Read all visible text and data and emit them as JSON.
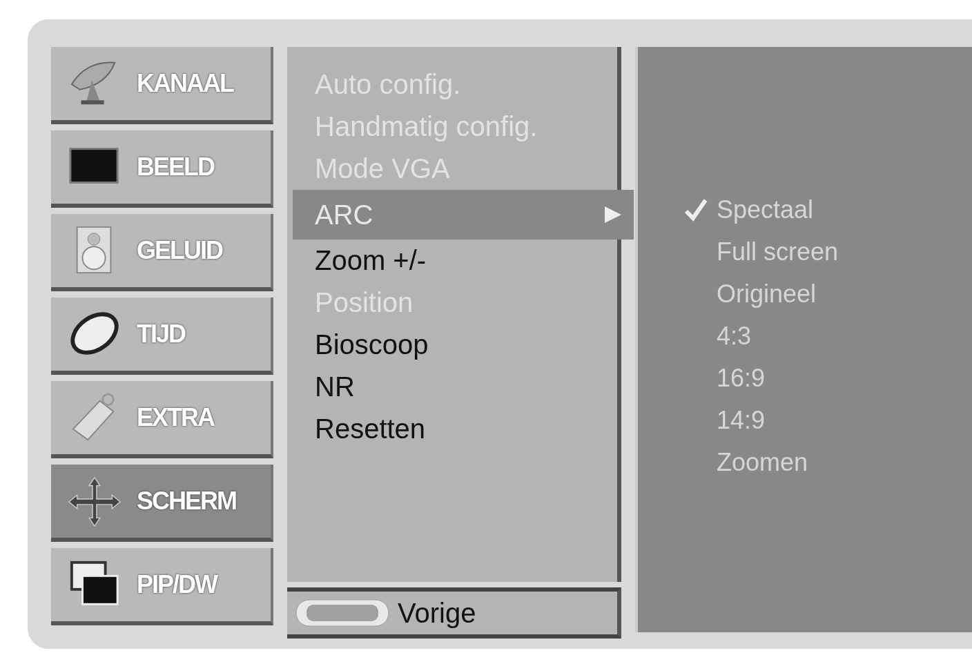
{
  "main_menu": [
    {
      "label": "KANAAL",
      "selected": false
    },
    {
      "label": "BEELD",
      "selected": false
    },
    {
      "label": "GELUID",
      "selected": false
    },
    {
      "label": "TIJD",
      "selected": false
    },
    {
      "label": "EXTRA",
      "selected": false
    },
    {
      "label": "SCHERM",
      "selected": true
    },
    {
      "label": "PIP/DW",
      "selected": false
    }
  ],
  "submenu": {
    "items": [
      {
        "label": "Auto config.",
        "disabled": true,
        "selected": false,
        "has_submenu": false
      },
      {
        "label": "Handmatig config.",
        "disabled": true,
        "selected": false,
        "has_submenu": false
      },
      {
        "label": "Mode VGA",
        "disabled": true,
        "selected": false,
        "has_submenu": false
      },
      {
        "label": "ARC",
        "disabled": false,
        "selected": true,
        "has_submenu": true
      },
      {
        "label": "Zoom +/-",
        "disabled": false,
        "selected": false,
        "has_submenu": false
      },
      {
        "label": "Position",
        "disabled": true,
        "selected": false,
        "has_submenu": false
      },
      {
        "label": "Bioscoop",
        "disabled": false,
        "selected": false,
        "has_submenu": false
      },
      {
        "label": "NR",
        "disabled": false,
        "selected": false,
        "has_submenu": false
      },
      {
        "label": "Resetten",
        "disabled": false,
        "selected": false,
        "has_submenu": false
      }
    ],
    "footer": {
      "hint": "Vorige"
    }
  },
  "options": [
    {
      "label": "Spectaal",
      "checked": true
    },
    {
      "label": "Full screen",
      "checked": false
    },
    {
      "label": "Origineel",
      "checked": false
    },
    {
      "label": "4:3",
      "checked": false
    },
    {
      "label": "16:9",
      "checked": false
    },
    {
      "label": "14:9",
      "checked": false
    },
    {
      "label": "Zoomen",
      "checked": false
    }
  ]
}
